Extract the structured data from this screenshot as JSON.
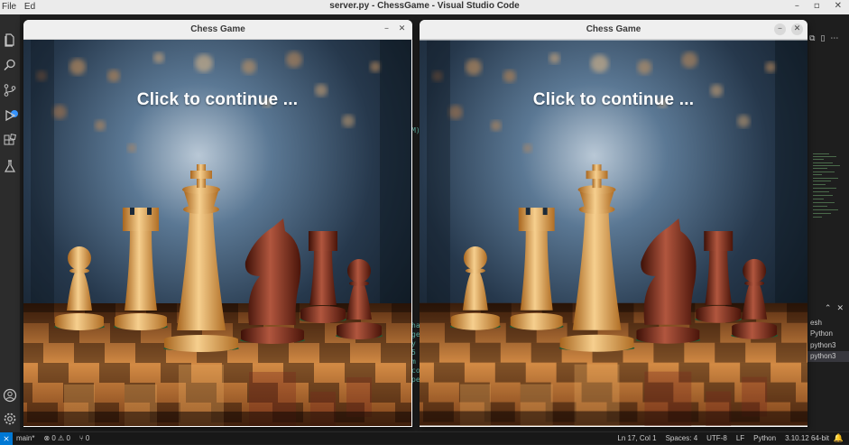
{
  "vscode": {
    "title": "server.py - ChessGame - Visual Studio Code",
    "menu": [
      "File",
      "Ed"
    ],
    "window_controls": [
      "–",
      "▫",
      "✕"
    ],
    "right_tools": [
      "⧉",
      "▯",
      "⋯"
    ],
    "middle_code_chars": [
      "M)",
      "ha",
      "ge",
      "y",
      "5",
      "m",
      "co",
      "pe"
    ],
    "terminal_tabs": [
      "esh",
      "Python",
      "python3",
      "python3"
    ],
    "terminal_active_index": 3,
    "panel_controls": [
      "⌃",
      "✕"
    ]
  },
  "status_bar": {
    "remote_icon": "⨯",
    "branch": "main*",
    "problems": "⊗ 0 ⚠ 0",
    "ports": "⑂ 0",
    "position": "Ln 17, Col 1",
    "spaces": "Spaces: 4",
    "encoding": "UTF-8",
    "eol": "LF",
    "language": "Python",
    "interpreter": "3.10.12 64-bit"
  },
  "windows": [
    {
      "title": "Chess Game",
      "prompt": "Click to continue ...",
      "min_label": "–",
      "close_label": "✕"
    },
    {
      "title": "Chess Game",
      "prompt": "Click to continue ...",
      "min_label": "–",
      "close_label": "✕"
    }
  ],
  "colors": {
    "accent": "#0078d4",
    "light_piece": "#e2a45a",
    "dark_piece": "#7a2a1c",
    "background_blue": "#3a5a7a"
  }
}
